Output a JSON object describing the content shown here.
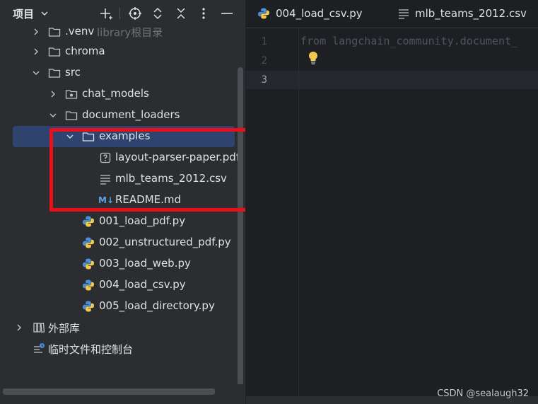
{
  "project_panel": {
    "title": "项目",
    "header_icons": [
      "add-icon",
      "crosshair-icon",
      "expand-all-icon",
      "collapse-all-icon",
      "more-options-icon",
      "minimize-icon"
    ],
    "tree": [
      {
        "label": ".venv",
        "suffix": "library根目录",
        "type": "folder",
        "state": "collapsed"
      },
      {
        "label": "chroma",
        "type": "folder",
        "state": "collapsed"
      },
      {
        "label": "src",
        "type": "folder",
        "state": "expanded"
      },
      {
        "label": "chat_models",
        "type": "package",
        "state": "collapsed"
      },
      {
        "label": "document_loaders",
        "type": "folder",
        "state": "expanded"
      },
      {
        "label": "examples",
        "type": "folder",
        "state": "expanded",
        "selected": true
      },
      {
        "label": "layout-parser-paper.pdf",
        "type": "unknown-file"
      },
      {
        "label": "mlb_teams_2012.csv",
        "type": "text-file"
      },
      {
        "label": "README.md",
        "type": "markdown-file",
        "badge": "M↓"
      },
      {
        "label": "001_load_pdf.py",
        "type": "python-file"
      },
      {
        "label": "002_unstructured_pdf.py",
        "type": "python-file"
      },
      {
        "label": "003_load_web.py",
        "type": "python-file"
      },
      {
        "label": "004_load_csv.py",
        "type": "python-file"
      },
      {
        "label": "005_load_directory.py",
        "type": "python-file"
      },
      {
        "label": "外部库",
        "type": "library",
        "state": "collapsed"
      },
      {
        "label": "临时文件和控制台",
        "type": "scratches"
      }
    ]
  },
  "editor": {
    "tabs": [
      {
        "label": "004_load_csv.py",
        "icon": "python-file-icon"
      },
      {
        "label": "mlb_teams_2012.csv",
        "icon": "text-file-icon"
      }
    ],
    "line_numbers": [
      "1",
      "2",
      "3"
    ],
    "current_line": "3",
    "code_lines": [
      "from langchain_community.document_"
    ]
  },
  "watermark": "CSDN @sealaugh32",
  "colors": {
    "panel_bg": "#2b2d30",
    "editor_bg": "#1e1f22",
    "selection": "#2e436e",
    "highlight_box": "#e8101a",
    "python_blue": "#4a8fd8",
    "python_yellow": "#f2c94c"
  }
}
